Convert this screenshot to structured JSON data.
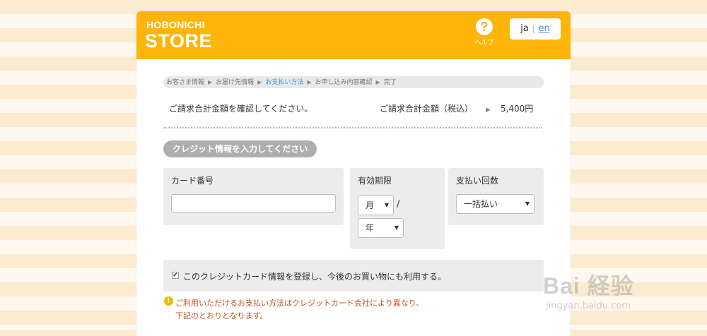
{
  "header": {
    "brand_top": "HOBONICHI",
    "brand_main": "STORE",
    "help_symbol": "?",
    "help_label": "ヘルプ",
    "lang_ja": "ja",
    "lang_sep": "|",
    "lang_en": "en"
  },
  "steps": [
    "お客さま情報",
    "お届け先情報",
    "お支払い方法",
    "お申し込み内容確認",
    "完了"
  ],
  "active_step": 2,
  "summary": {
    "message": "ご請求合計金額を確認してください。",
    "total_label": "ご請求合計金額（税込）",
    "total_arrow": "▶",
    "total_value": "5,400円"
  },
  "section_title": "クレジット情報を入力してください",
  "card_number": {
    "label": "カード番号",
    "value": ""
  },
  "expiry": {
    "label": "有効期限",
    "month_value": "月",
    "separator": "/",
    "year_value": "年"
  },
  "installments": {
    "label": "支払い回数",
    "value": "一括払い"
  },
  "register": {
    "checked": true,
    "check_mark": "✔",
    "text": "このクレジットカード情報を登録し、今後のお買い物にも利用する。"
  },
  "notice": {
    "icon": "!",
    "line1": "ご利用いただけるお支払い方法はクレジットカード会社により異なり、",
    "line2": "下記のとおりとなります。"
  },
  "watermark": {
    "main": "Bai 経验",
    "sub": "jingyan.baidu.com"
  },
  "colors": {
    "brand": "#fcb508",
    "link": "#3a9ad9",
    "notice_text": "#c8501e",
    "pill": "#aeaeae"
  }
}
